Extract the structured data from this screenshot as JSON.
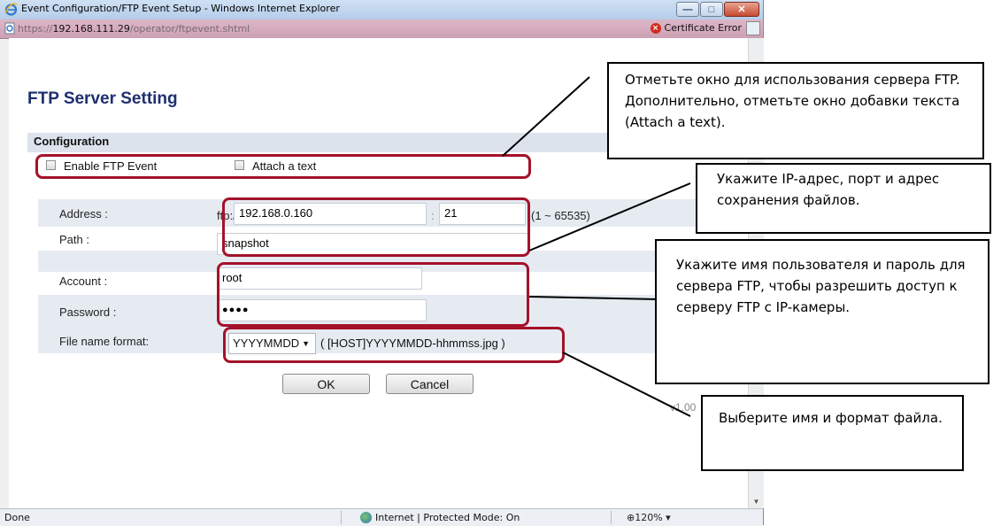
{
  "window": {
    "title": "Event Configuration/FTP Event Setup - Windows Internet Explorer",
    "url_prefix": "https://",
    "url_host": "192.168.111.29",
    "url_path": "/operator/ftpevent.shtml",
    "cert_error": "Certificate Error"
  },
  "page": {
    "title": "FTP Server Setting",
    "section_title": "Configuration",
    "enable_ftp_label": "Enable FTP Event",
    "attach_text_label": "Attach a text",
    "address_label": "Address :",
    "ftp_prefix": "ftp://",
    "address_value": "192.168.0.160",
    "port_sep": ":",
    "port_value": "21",
    "port_range": "(1 ~ 65535)",
    "path_label": "Path :",
    "path_value": "snapshot",
    "account_label": "Account :",
    "account_value": "root",
    "password_label": "Password :",
    "password_value": "●●●●",
    "filename_label": "File name format:",
    "filename_select": "YYYYMMDD",
    "filename_example": "( [HOST]YYYYMMDD-hhmmss.jpg )",
    "ok_label": "OK",
    "cancel_label": "Cancel",
    "version": "v1.00"
  },
  "status": {
    "done": "Done",
    "zone": "Internet | Protected Mode: On",
    "zoom": "120%"
  },
  "callouts": {
    "c1": "Отметьте окно для использования сервера FTP. Дополнительно, отметьте окно добавки текста (Attach a text).",
    "c2": "Укажите IP-адрес, порт и адрес сохранения файлов.",
    "c3": "Укажите имя пользователя и пароль для сервера FTP, чтобы разрешить доступ к серверу FTP с IP-камеры.",
    "c4": "Выберите имя и формат файла."
  },
  "colors": {
    "highlight": "#a4122a",
    "title_blue": "#1f2f6f"
  }
}
